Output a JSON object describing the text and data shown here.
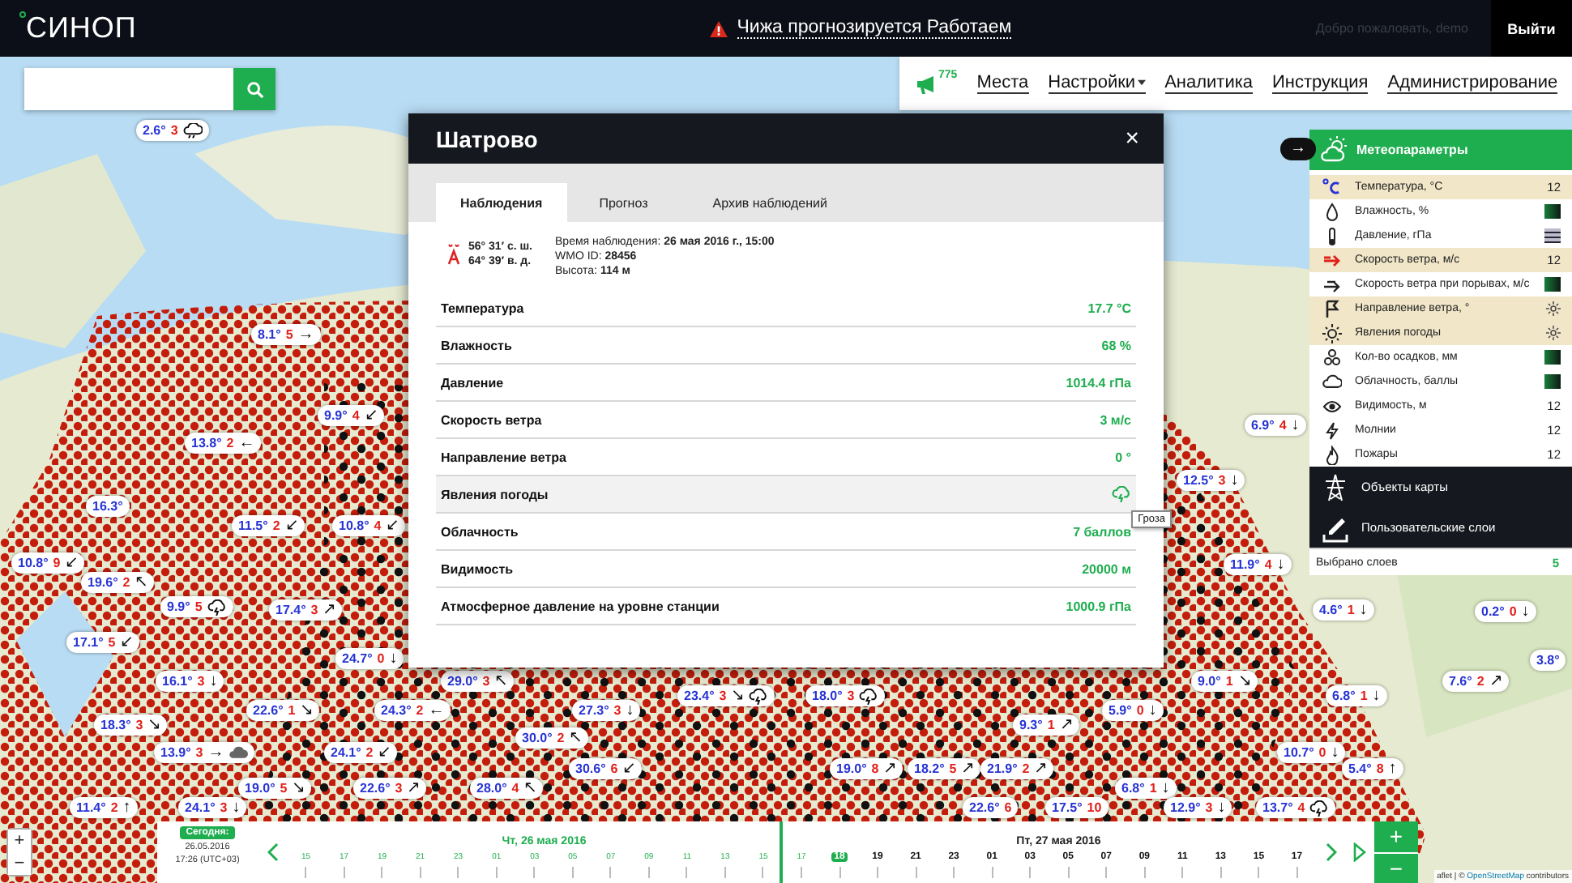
{
  "topbar": {
    "logo": "СИНОП",
    "alert": "Чижа прогнозируется Работаем",
    "welcome": "Добро пожаловать, demo",
    "logout": "Выйти"
  },
  "nav": {
    "badge": "775",
    "items": [
      {
        "label": "Места",
        "dropdown": false
      },
      {
        "label": "Настройки",
        "dropdown": true
      },
      {
        "label": "Аналитика",
        "dropdown": false
      },
      {
        "label": "Инструкция",
        "dropdown": false
      },
      {
        "label": "Администрирование",
        "dropdown": false
      }
    ]
  },
  "stations": [
    {
      "temp": "2.6°",
      "wind": "3",
      "kind": "rain"
    },
    {
      "temp": "8.1°",
      "wind": "5",
      "arrow": "→"
    },
    {
      "temp": "9.9°",
      "wind": "4",
      "arrow": "↙"
    },
    {
      "temp": "6.9°",
      "wind": "4",
      "arrow": "↓"
    },
    {
      "temp": "13.8°",
      "wind": "2",
      "arrow": "←"
    },
    {
      "temp": "12.5°",
      "wind": "3",
      "arrow": "↓"
    },
    {
      "temp": "16.3°"
    },
    {
      "temp": "11.5°",
      "wind": "2",
      "arrow": "↙"
    },
    {
      "temp": "10.8°",
      "wind": "4",
      "arrow": "↙"
    },
    {
      "temp": "10.8°",
      "wind": "9",
      "arrow": "↙"
    },
    {
      "temp": "11.9°",
      "wind": "4",
      "arrow": "↓"
    },
    {
      "temp": "19.6°",
      "wind": "2",
      "arrow": "↖"
    },
    {
      "temp": "9.9°",
      "wind": "5",
      "kind": "storm"
    },
    {
      "temp": "17.4°",
      "wind": "3",
      "arrow": "↗"
    },
    {
      "temp": "4.6°",
      "wind": "1",
      "arrow": "↓"
    },
    {
      "temp": "0.2°",
      "wind": "0",
      "arrow": "↓"
    },
    {
      "temp": "17.1°",
      "wind": "5",
      "arrow": "↙"
    },
    {
      "temp": "24.7°",
      "wind": "0",
      "arrow": "↓"
    },
    {
      "temp": "3.8°"
    },
    {
      "temp": "16.1°",
      "wind": "3",
      "arrow": "↓"
    },
    {
      "temp": "29.0°",
      "wind": "3",
      "arrow": "↖"
    },
    {
      "temp": "9.0°",
      "wind": "1",
      "arrow": "↘"
    },
    {
      "temp": "7.6°",
      "wind": "2",
      "arrow": "↗"
    },
    {
      "temp": "23.4°",
      "wind": "3",
      "arrow": "↘",
      "kind": "storm"
    },
    {
      "temp": "18.0°",
      "wind": "3",
      "kind": "storm"
    },
    {
      "temp": "6.8°",
      "wind": "1",
      "arrow": "↓"
    },
    {
      "temp": "22.6°",
      "wind": "1",
      "arrow": "↘"
    },
    {
      "temp": "24.3°",
      "wind": "2",
      "arrow": "←"
    },
    {
      "temp": "27.3°",
      "wind": "3",
      "arrow": "↓"
    },
    {
      "temp": "5.9°",
      "wind": "0",
      "arrow": "↓"
    },
    {
      "temp": "18.3°",
      "wind": "3",
      "arrow": "↘"
    },
    {
      "temp": "9.3°",
      "wind": "1",
      "arrow": "↗"
    },
    {
      "temp": "30.0°",
      "wind": "2",
      "arrow": "↖"
    },
    {
      "temp": "13.9°",
      "wind": "3",
      "arrow": "→",
      "kind": "cloud"
    },
    {
      "temp": "24.1°",
      "wind": "2",
      "arrow": "↙"
    },
    {
      "temp": "10.7°",
      "wind": "0",
      "arrow": "↓"
    },
    {
      "temp": "30.6°",
      "wind": "6",
      "arrow": "↙"
    },
    {
      "temp": "19.0°",
      "wind": "8",
      "arrow": "↗"
    },
    {
      "temp": "18.2°",
      "wind": "5",
      "arrow": "↗"
    },
    {
      "temp": "21.9°",
      "wind": "2",
      "arrow": "↗"
    },
    {
      "temp": "5.4°",
      "wind": "8",
      "arrow": "↑"
    },
    {
      "temp": "19.0°",
      "wind": "5",
      "arrow": "↘"
    },
    {
      "temp": "22.6°",
      "wind": "3",
      "arrow": "↗"
    },
    {
      "temp": "28.0°",
      "wind": "4",
      "arrow": "↖"
    },
    {
      "temp": "6.8°",
      "wind": "1",
      "arrow": "↓"
    },
    {
      "temp": "11.4°",
      "wind": "2",
      "arrow": "↑"
    },
    {
      "temp": "24.1°",
      "wind": "3",
      "arrow": "↓"
    },
    {
      "temp": "22.6°",
      "wind": "6"
    },
    {
      "temp": "17.5°",
      "wind": "10"
    },
    {
      "temp": "12.9°",
      "wind": "3",
      "arrow": "↓"
    },
    {
      "temp": "13.7°",
      "wind": "4",
      "kind": "storm"
    }
  ],
  "popup": {
    "title": "Шатрово",
    "close": "×",
    "tabs": [
      {
        "label": "Наблюдения",
        "selected": true
      },
      {
        "label": "Прогноз",
        "selected": false
      },
      {
        "label": "Архив наблюдений",
        "selected": false
      }
    ],
    "coords": [
      "56° 31′ с. ш.",
      "64° 39′ в. д."
    ],
    "meta": [
      "Время наблюдения: **26 мая 2016 г., 15:00**",
      "WMO ID: **28456**",
      "Высота: **114 м**"
    ],
    "rows": [
      {
        "label": "Температура",
        "value": "17.7 °C",
        "highlighted": false
      },
      {
        "label": "Влажность",
        "value": "68 %",
        "highlighted": false
      },
      {
        "label": "Давление",
        "value": "1014.4 гПа",
        "highlighted": false
      },
      {
        "label": "Скорость ветра",
        "value": "3 м/с",
        "highlighted": false
      },
      {
        "label": "Направление ветра",
        "value": "0 °",
        "highlighted": false
      },
      {
        "label": "Явления погоды",
        "kind": "icon",
        "tooltip": "Гроза",
        "highlighted": true
      },
      {
        "label": "Облачность",
        "value": "7 баллов",
        "highlighted": false
      },
      {
        "label": "Видимость",
        "value": "20000 м",
        "highlighted": false
      },
      {
        "label": "Атмосферное давление на уровне станции",
        "value": "1000.9 гПа",
        "highlighted": false
      }
    ]
  },
  "layers": {
    "toggle": "→",
    "title": "Метеопараметры",
    "items": [
      {
        "label": "Температура, °C",
        "selected": true,
        "kind": "count",
        "count": "12"
      },
      {
        "label": "Влажность, %",
        "selected": false,
        "kind": "gradient"
      },
      {
        "label": "Давление, гПа",
        "selected": false,
        "kind": "pattern"
      },
      {
        "label": "Скорость ветра, м/с",
        "selected": true,
        "kind": "count",
        "count": "12"
      },
      {
        "label": "Скорость ветра при порывах, м/с",
        "selected": false,
        "kind": "gradient"
      },
      {
        "label": "Направление ветра, °",
        "selected": true,
        "kind": "sun"
      },
      {
        "label": "Явления погоды",
        "selected": true,
        "kind": "sun"
      },
      {
        "label": "Кол-во осадков, мм",
        "selected": false,
        "kind": "gradient"
      },
      {
        "label": "Облачность, баллы",
        "selected": false,
        "kind": "gradient"
      },
      {
        "label": "Видимость, м",
        "selected": false,
        "kind": "count",
        "count": "12"
      },
      {
        "label": "Молнии",
        "selected": false,
        "kind": "count",
        "count": "12"
      },
      {
        "label": "Пожары",
        "selected": false,
        "kind": "count",
        "count": "12"
      }
    ],
    "sections": [
      "Объекты карты",
      "Пользовательские слои"
    ],
    "selected_label": "Выбрано слоев",
    "selected_count": "5"
  },
  "zoom": [
    "+",
    "−"
  ],
  "attribution": {
    "prefix": "aflet | © ",
    "link": "OpenStreetMap",
    "suffix": " contributors"
  },
  "timeline": {
    "today_label": "Сегодня:",
    "date": "26.05.2016",
    "time": "17:26",
    "tz": "(UTC+03)",
    "days": [
      "Чт, 26 мая 2016",
      "Пт, 27 мая 2016"
    ],
    "hours": [
      {
        "label": "15",
        "past": true,
        "selected": false
      },
      {
        "label": "17",
        "past": true,
        "selected": false
      },
      {
        "label": "19",
        "past": true,
        "selected": false
      },
      {
        "label": "21",
        "past": true,
        "selected": false
      },
      {
        "label": "23",
        "past": true,
        "selected": false
      },
      {
        "label": "01",
        "past": true,
        "selected": false
      },
      {
        "label": "03",
        "past": true,
        "selected": false
      },
      {
        "label": "05",
        "past": true,
        "selected": false
      },
      {
        "label": "07",
        "past": true,
        "selected": false
      },
      {
        "label": "09",
        "past": true,
        "selected": false
      },
      {
        "label": "11",
        "past": true,
        "selected": false
      },
      {
        "label": "13",
        "past": true,
        "selected": false
      },
      {
        "label": "15",
        "past": true,
        "selected": false
      },
      {
        "label": "17",
        "past": true,
        "selected": false
      },
      {
        "label": "18",
        "past": false,
        "selected": true
      },
      {
        "label": "19",
        "past": false,
        "selected": false
      },
      {
        "label": "21",
        "past": false,
        "selected": false
      },
      {
        "label": "23",
        "past": false,
        "selected": false
      },
      {
        "label": "01",
        "past": false,
        "selected": false
      },
      {
        "label": "03",
        "past": false,
        "selected": false
      },
      {
        "label": "05",
        "past": false,
        "selected": false
      },
      {
        "label": "07",
        "past": false,
        "selected": false
      },
      {
        "label": "09",
        "past": false,
        "selected": false
      },
      {
        "label": "11",
        "past": false,
        "selected": false
      },
      {
        "label": "13",
        "past": false,
        "selected": false
      },
      {
        "label": "15",
        "past": false,
        "selected": false
      },
      {
        "label": "17",
        "past": false,
        "selected": false
      }
    ],
    "zoom": [
      "+",
      "−"
    ]
  }
}
